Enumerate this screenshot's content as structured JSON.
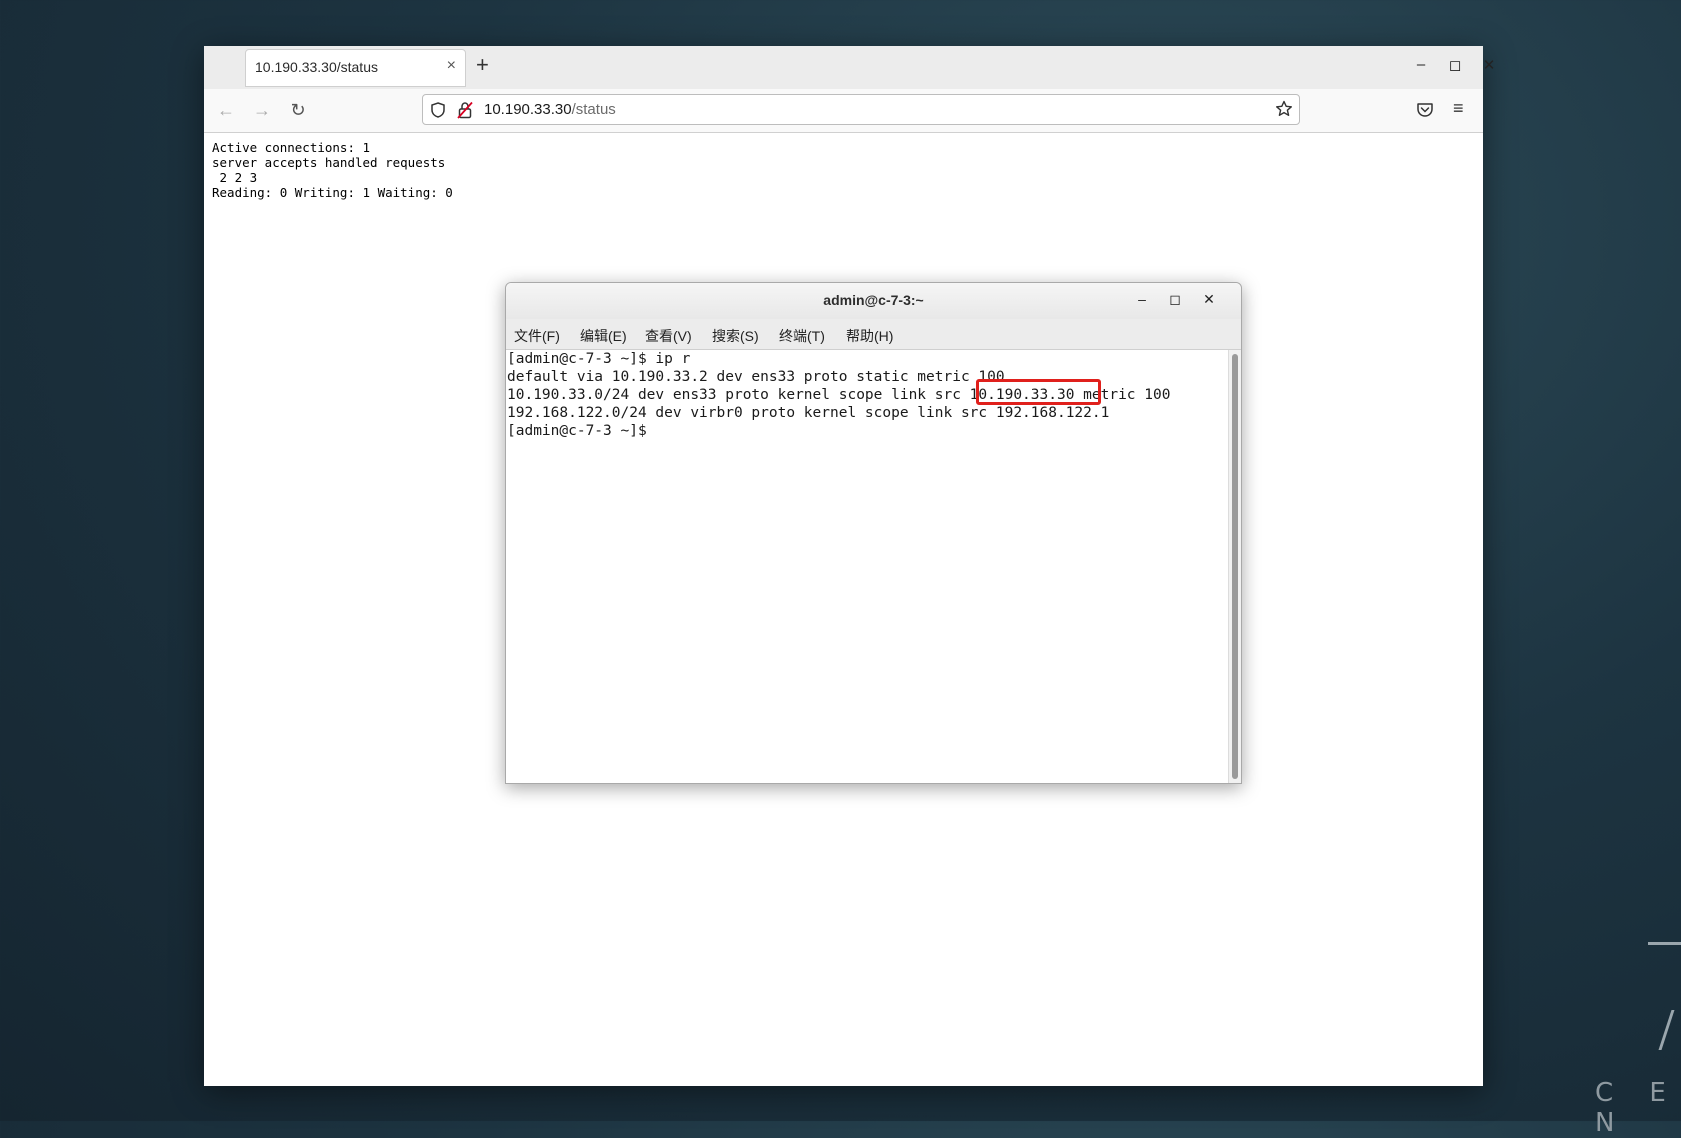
{
  "desktop": {
    "wordmark": "C E N"
  },
  "browser": {
    "tab": {
      "title": "10.190.33.30/status",
      "close": "×"
    },
    "new_tab": "+",
    "window_controls": {
      "minimize": "–",
      "maximize": "◻",
      "close": "✕"
    },
    "nav": {
      "back": "←",
      "forward": "→",
      "reload": "↻",
      "menu": "≡"
    },
    "url": {
      "host": "10.190.33.30",
      "path": "/status"
    },
    "page_text": "Active connections: 1\nserver accepts handled requests\n 2 2 3\nReading: 0 Writing: 1 Waiting: 0"
  },
  "terminal": {
    "title": "admin@c-7-3:~",
    "window_controls": {
      "minimize": "–",
      "maximize": "◻",
      "close": "✕"
    },
    "menu": [
      "文件(F)",
      "编辑(E)",
      "查看(V)",
      "搜索(S)",
      "终端(T)",
      "帮助(H)"
    ],
    "lines": [
      "[admin@c-7-3 ~]$ ip r",
      "default via 10.190.33.2 dev ens33 proto static metric 100",
      "10.190.33.0/24 dev ens33 proto kernel scope link src 10.190.33.30 metric 100",
      "192.168.122.0/24 dev virbr0 proto kernel scope link src 192.168.122.1",
      "[admin@c-7-3 ~]$"
    ],
    "highlight_color": "#e0201c"
  }
}
